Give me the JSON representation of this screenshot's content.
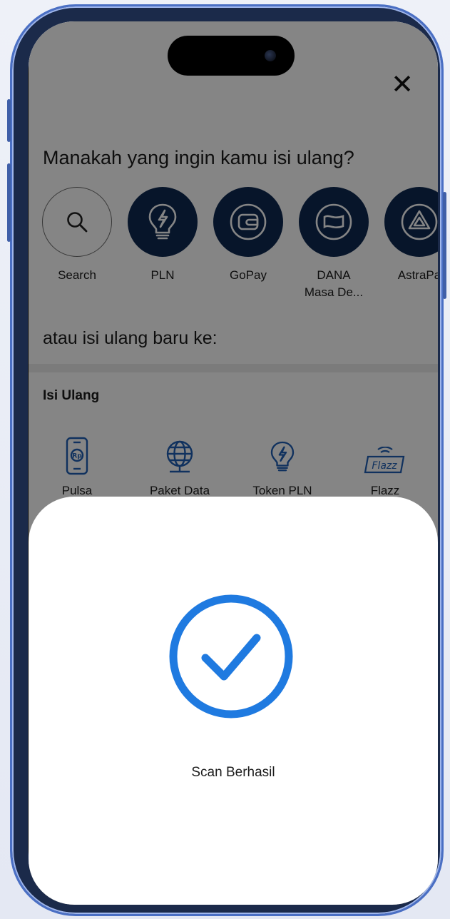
{
  "header": {
    "close_label": "✕"
  },
  "question": "Manakah yang ingin kamu isi ulang?",
  "favorites": [
    {
      "label": "Search",
      "icon": "search-icon"
    },
    {
      "label": "PLN",
      "icon": "bulb-bolt-icon"
    },
    {
      "label": "GoPay",
      "icon": "wallet-icon"
    },
    {
      "label": "DANA\nMasa De...",
      "icon": "dana-flag-icon"
    },
    {
      "label": "AstraPa",
      "icon": "astrapay-icon"
    }
  ],
  "new_topup_heading": "atau isi ulang baru ke:",
  "section_title": "Isi Ulang",
  "services": [
    {
      "label": "Pulsa",
      "icon": "phone-rp-icon"
    },
    {
      "label": "Paket Data",
      "icon": "globe-icon"
    },
    {
      "label": "Token PLN",
      "icon": "bulb-bolt-icon"
    },
    {
      "label": "Flazz",
      "icon": "flazz-card-icon"
    }
  ],
  "success_sheet": {
    "message": "Scan Berhasil",
    "icon": "check-circle-icon"
  },
  "colors": {
    "primary": "#0f2a52",
    "icon_blue": "#1f5fb5",
    "success_blue": "#1f7ae0"
  }
}
